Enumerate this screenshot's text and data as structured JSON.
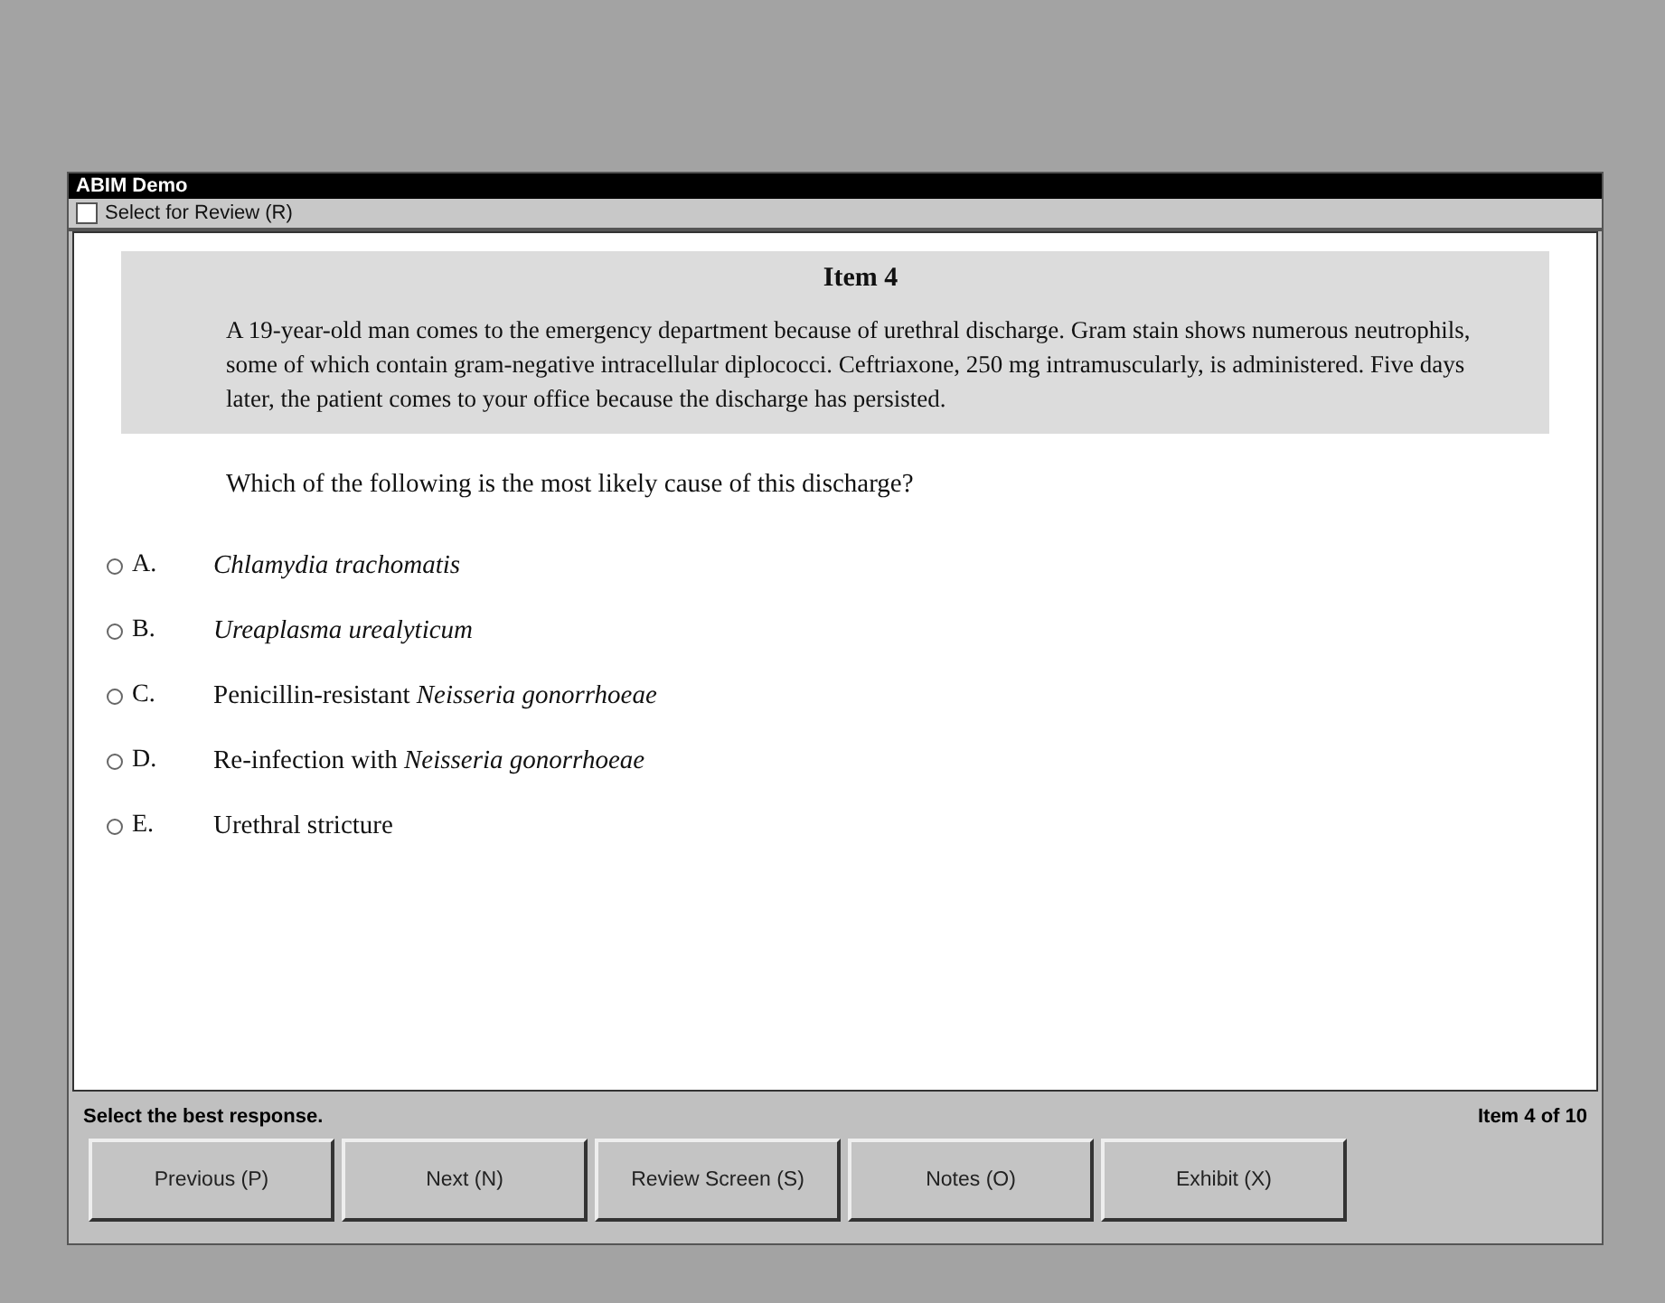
{
  "window": {
    "title": "ABIM Demo"
  },
  "review": {
    "label": "Select for Review (R)",
    "checked": false
  },
  "question": {
    "title": "Item 4",
    "stem": "A 19-year-old man comes to the emergency department because of urethral discharge. Gram stain shows numerous neutrophils, some of which contain gram-negative intracellular diplococci. Ceftriaxone, 250 mg intramuscularly, is administered. Five days later, the patient comes to your office because the discharge has persisted.",
    "prompt": "Which of the following is the most likely cause of this discharge?"
  },
  "options": [
    {
      "letter": "A.",
      "text": "Chlamydia trachomatis",
      "italic": true,
      "selected": false
    },
    {
      "letter": "B.",
      "text": "Ureaplasma urealyticum",
      "italic": true,
      "selected": false
    },
    {
      "letter": "C.",
      "text": "Penicillin-resistant *Neisseria gonorrhoeae*",
      "italic": false,
      "selected": false
    },
    {
      "letter": "D.",
      "text": "Re-infection with *Neisseria gonorrhoeae*",
      "italic": false,
      "selected": false
    },
    {
      "letter": "E.",
      "text": "Urethral stricture",
      "italic": false,
      "selected": false
    }
  ],
  "status_bar": {
    "instruction": "Select the best response.",
    "progress": "Item 4 of 10"
  },
  "buttons": [
    "Previous (P)",
    "Next (N)",
    "Review Screen (S)",
    "Notes (O)",
    "Exhibit (X)"
  ]
}
